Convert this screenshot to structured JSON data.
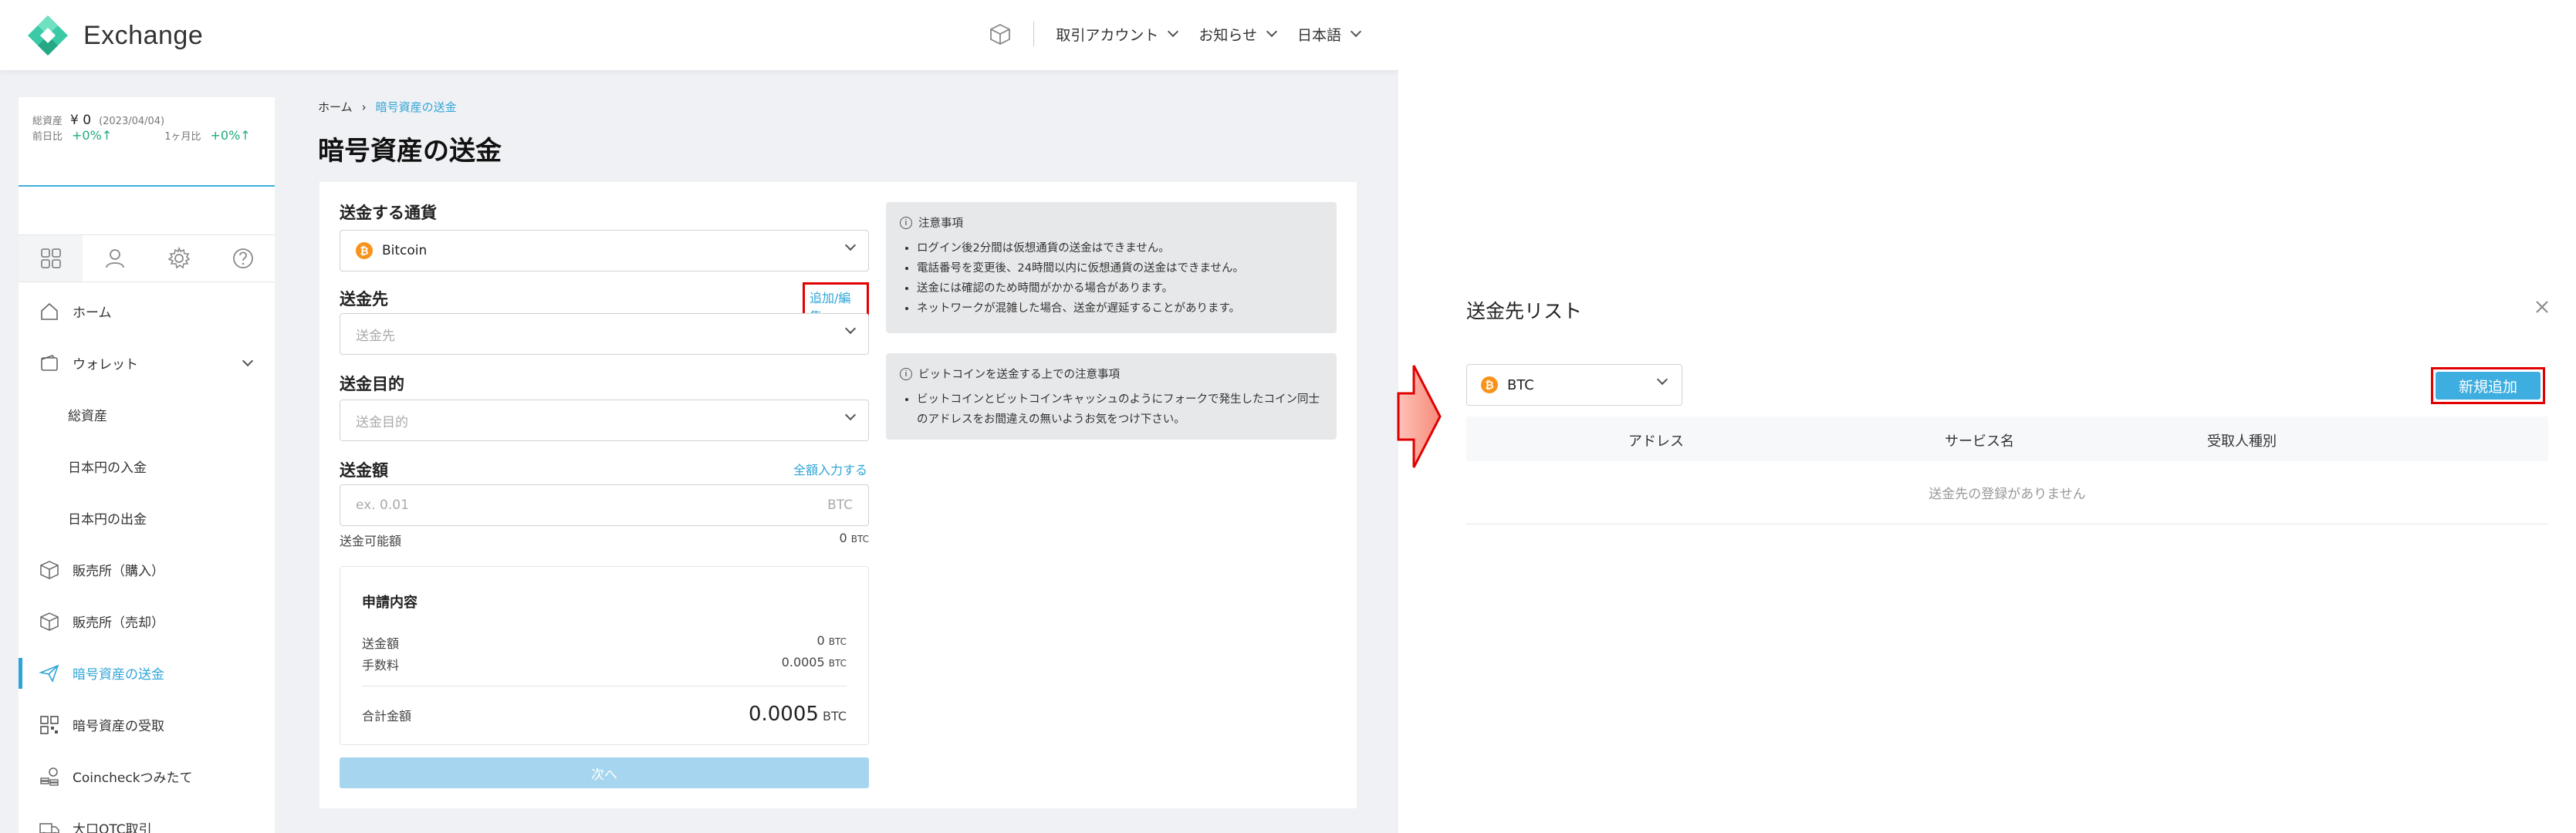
{
  "header": {
    "logo_text": "Exchange",
    "nav": [
      "取引アカウント",
      "お知らせ",
      "日本語"
    ]
  },
  "sidebar": {
    "total_assets_label": "総資産",
    "total_assets_value": "¥ 0",
    "total_assets_date": "(2023/04/04)",
    "prev_day_label": "前日比",
    "prev_day_value": "+0%↑",
    "month_label": "1ヶ月比",
    "month_value": "+0%↑",
    "menu": [
      {
        "label": "ホーム",
        "icon": "home-icon"
      },
      {
        "label": "ウォレット",
        "icon": "wallet-icon"
      },
      {
        "label": "総資産",
        "icon": ""
      },
      {
        "label": "日本円の入金",
        "icon": ""
      },
      {
        "label": "日本円の出金",
        "icon": ""
      },
      {
        "label": "販売所（購入）",
        "icon": "cube-icon"
      },
      {
        "label": "販売所（売却）",
        "icon": "cube-icon"
      },
      {
        "label": "暗号資産の送金",
        "icon": "paper-plane-icon"
      },
      {
        "label": "暗号資産の受取",
        "icon": "qr-code-icon"
      },
      {
        "label": "Coincheckつみたて",
        "icon": "coins-icon"
      },
      {
        "label": "大口OTC取引",
        "icon": "truck-icon"
      }
    ]
  },
  "breadcrumb": {
    "home": "ホーム",
    "current": "暗号資産の送金"
  },
  "page_title": "暗号資産の送金",
  "form": {
    "currency_label": "送金する通貨",
    "currency_value": "Bitcoin",
    "destination_label": "送金先",
    "destination_link": "追加/編集",
    "destination_placeholder": "送金先",
    "purpose_label": "送金目的",
    "purpose_placeholder": "送金目的",
    "amount_label": "送金額",
    "amount_link": "全額入力する",
    "amount_placeholder": "ex. 0.01",
    "amount_unit": "BTC",
    "available_label": "送金可能額",
    "available_value": "0",
    "available_unit": "BTC",
    "summary_title": "申請内容",
    "summary_amount_label": "送金額",
    "summary_amount_value": "0",
    "summary_fee_label": "手数料",
    "summary_fee_value": "0.0005",
    "total_label": "合計金額",
    "total_value": "0.0005",
    "unit": "BTC",
    "next_button": "次へ"
  },
  "notes": {
    "caution_title": "注意事項",
    "caution_items": [
      "ログイン後2分間は仮想通貨の送金はできません。",
      "電話番号を変更後、24時間以内に仮想通貨の送金はできません。",
      "送金には確認のため時間がかかる場合があります。",
      "ネットワークが混雑した場合、送金が遅延することがあります。"
    ],
    "btc_title": "ビットコインを送金する上での注意事項",
    "btc_items": [
      "ビットコインとビットコインキャッシュのようにフォークで発生したコイン同士のアドレスをお間違えの無いようお気をつけ下さい。"
    ]
  },
  "modal": {
    "title": "送金先リスト",
    "currency": "BTC",
    "add_button": "新規追加",
    "columns": [
      "アドレス",
      "サービス名",
      "受取人種別"
    ],
    "empty_text": "送金先の登録がありません"
  },
  "colors": {
    "accent": "#2fa5d7",
    "button_disabled": "#a6d6ef",
    "highlight": "#e00000",
    "bitcoin": "#f7931a",
    "logo": "#3ccaa6"
  }
}
